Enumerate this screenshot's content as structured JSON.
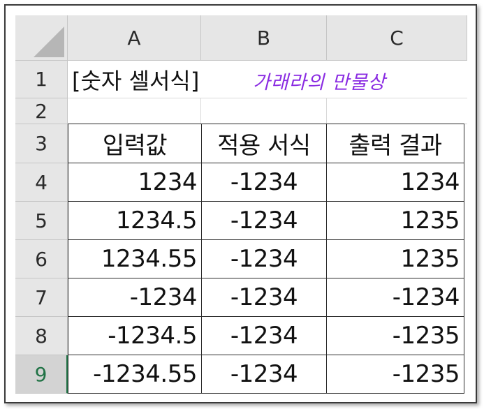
{
  "columns": [
    "A",
    "B",
    "C"
  ],
  "rows": [
    "1",
    "2",
    "3",
    "4",
    "5",
    "6",
    "7",
    "8",
    "9"
  ],
  "title_cell": "[숫자 셀서식]",
  "watermark": "가래라의 만물상",
  "table": {
    "headers": [
      "입력값",
      "적용 서식",
      "출력 결과"
    ],
    "data": [
      [
        "1234",
        "-1234",
        "1234"
      ],
      [
        "1234.5",
        "-1234",
        "1235"
      ],
      [
        "1234.55",
        "-1234",
        "1235"
      ],
      [
        "-1234",
        "-1234",
        "-1234"
      ],
      [
        "-1234.5",
        "-1234",
        "-1235"
      ],
      [
        "-1234.55",
        "-1234",
        "-1235"
      ]
    ]
  },
  "active_row": "9",
  "colors": {
    "header_bg": "#e6e6e6",
    "accent_green": "#217346",
    "watermark": "#8a2be2"
  }
}
